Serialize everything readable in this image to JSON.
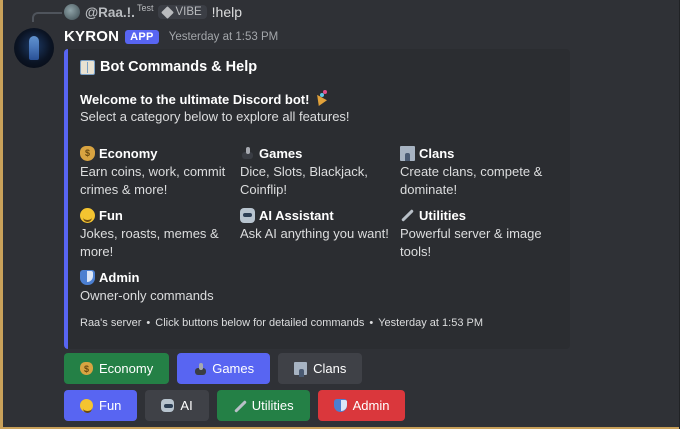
{
  "reply": {
    "username": "@Raa.!.",
    "tag": "Test",
    "badge": "VIBE",
    "command": "!help"
  },
  "message": {
    "bot_name": "KYRON",
    "app_badge": "APP",
    "timestamp": "Yesterday at 1:53 PM"
  },
  "embed": {
    "title": "Bot Commands & Help",
    "welcome": "Welcome to the ultimate Discord bot!",
    "subtitle": "Select a category below to explore all features!",
    "fields": [
      {
        "name": "Economy",
        "value": "Earn coins, work, commit crimes & more!",
        "icon": "moneybag-icon"
      },
      {
        "name": "Games",
        "value": "Dice, Slots, Blackjack, Coinflip!",
        "icon": "joystick-icon"
      },
      {
        "name": "Clans",
        "value": "Create clans, compete & dominate!",
        "icon": "castle-icon"
      },
      {
        "name": "Fun",
        "value": "Jokes, roasts, memes & more!",
        "icon": "smile-icon"
      },
      {
        "name": "AI Assistant",
        "value": "Ask AI anything you want!",
        "icon": "robot-icon"
      },
      {
        "name": "Utilities",
        "value": "Powerful server & image tools!",
        "icon": "wrench-icon"
      },
      {
        "name": "Admin",
        "value": "Owner-only commands",
        "icon": "shield-icon"
      }
    ],
    "footer": {
      "server": "Raa's server",
      "hint": "Click buttons below for detailed commands",
      "timestamp": "Yesterday at 1:53 PM",
      "separator": "•"
    },
    "accent_color": "#5865f2"
  },
  "buttons": {
    "economy": "Economy",
    "games": "Games",
    "clans": "Clans",
    "fun": "Fun",
    "ai": "AI",
    "utilities": "Utilities",
    "admin": "Admin"
  }
}
